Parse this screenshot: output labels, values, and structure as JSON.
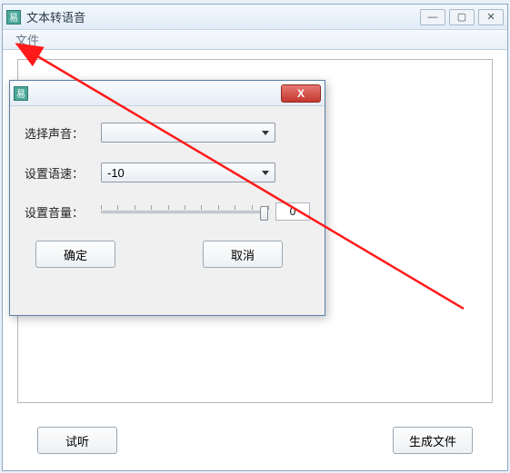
{
  "window": {
    "title": "文本转语音",
    "app_icon_glyph": "易",
    "menu": {
      "file": "文件"
    }
  },
  "main": {
    "preview_button": "试听",
    "generate_button": "生成文件"
  },
  "dialog": {
    "icon_glyph": "易",
    "close_glyph": "X",
    "labels": {
      "voice": "选择声音：",
      "speed": "设置语速：",
      "volume": "设置音量："
    },
    "voice_value": "",
    "speed_value": "-10",
    "volume_value": "0",
    "ok": "确定",
    "cancel": "取消"
  },
  "annotation": {
    "arrow_color": "#ff1a1a"
  }
}
